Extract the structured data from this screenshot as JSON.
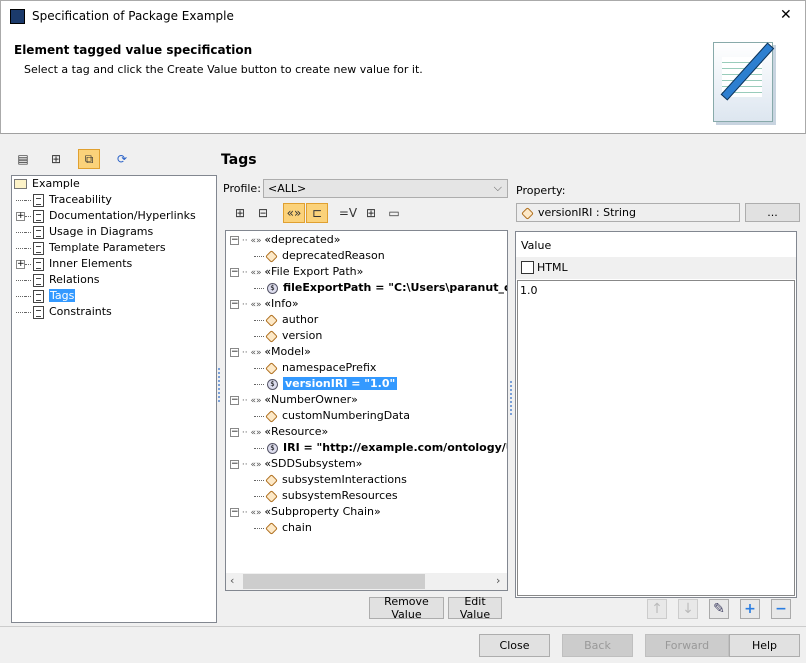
{
  "window": {
    "title": "Specification of Package Example",
    "close": "✕"
  },
  "header": {
    "title": "Element tagged value specification",
    "subtitle": "Select a tag and click the Create Value button to create new value for it."
  },
  "left_tree": {
    "root": "Example",
    "items": [
      {
        "label": "Traceability",
        "expandable": false
      },
      {
        "label": "Documentation/Hyperlinks",
        "expandable": true
      },
      {
        "label": "Usage in Diagrams",
        "expandable": false
      },
      {
        "label": "Template Parameters",
        "expandable": false
      },
      {
        "label": "Inner Elements",
        "expandable": true
      },
      {
        "label": "Relations",
        "expandable": false
      },
      {
        "label": "Tags",
        "expandable": false,
        "selected": true
      },
      {
        "label": "Constraints",
        "expandable": false
      }
    ]
  },
  "tags": {
    "heading": "Tags",
    "profile_label": "Profile:",
    "profile_value": "<ALL>",
    "rows": [
      {
        "level": 0,
        "text": "«deprecated»"
      },
      {
        "level": 1,
        "kind": "prop",
        "text": "deprecatedReason"
      },
      {
        "level": 0,
        "text": "«File Export Path»"
      },
      {
        "level": 1,
        "kind": "value",
        "text": "fileExportPath = \"C:\\Users\\paranut_c\\D"
      },
      {
        "level": 0,
        "text": "«Info»"
      },
      {
        "level": 1,
        "kind": "prop",
        "text": "author"
      },
      {
        "level": 1,
        "kind": "prop",
        "text": "version"
      },
      {
        "level": 0,
        "text": "«Model»"
      },
      {
        "level": 1,
        "kind": "prop",
        "text": "namespacePrefix"
      },
      {
        "level": 1,
        "kind": "value",
        "text": "versionIRI = \"1.0\"",
        "selected": true
      },
      {
        "level": 0,
        "text": "«NumberOwner»"
      },
      {
        "level": 1,
        "kind": "prop",
        "text": "customNumberingData"
      },
      {
        "level": 0,
        "text": "«Resource»"
      },
      {
        "level": 1,
        "kind": "value",
        "text": "IRI = \"http://example.com/ontology/U"
      },
      {
        "level": 0,
        "text": "«SDDSubsystem»"
      },
      {
        "level": 1,
        "kind": "prop",
        "text": "subsystemInteractions"
      },
      {
        "level": 1,
        "kind": "prop",
        "text": "subsystemResources"
      },
      {
        "level": 0,
        "text": "«Subproperty Chain»"
      },
      {
        "level": 1,
        "kind": "prop",
        "text": "chain"
      }
    ],
    "remove_value": "Remove Value",
    "edit_value": "Edit Value"
  },
  "property": {
    "label": "Property:",
    "value": "versionIRI : String",
    "browse": "...",
    "value_header": "Value",
    "html_label": "HTML",
    "html_checked": false,
    "text": "1.0"
  },
  "footer": {
    "close": "Close",
    "back": "Back",
    "forward": "Forward",
    "help": "Help"
  },
  "colors": {
    "selection": "#3399ff",
    "highlight": "#fbd27a"
  }
}
